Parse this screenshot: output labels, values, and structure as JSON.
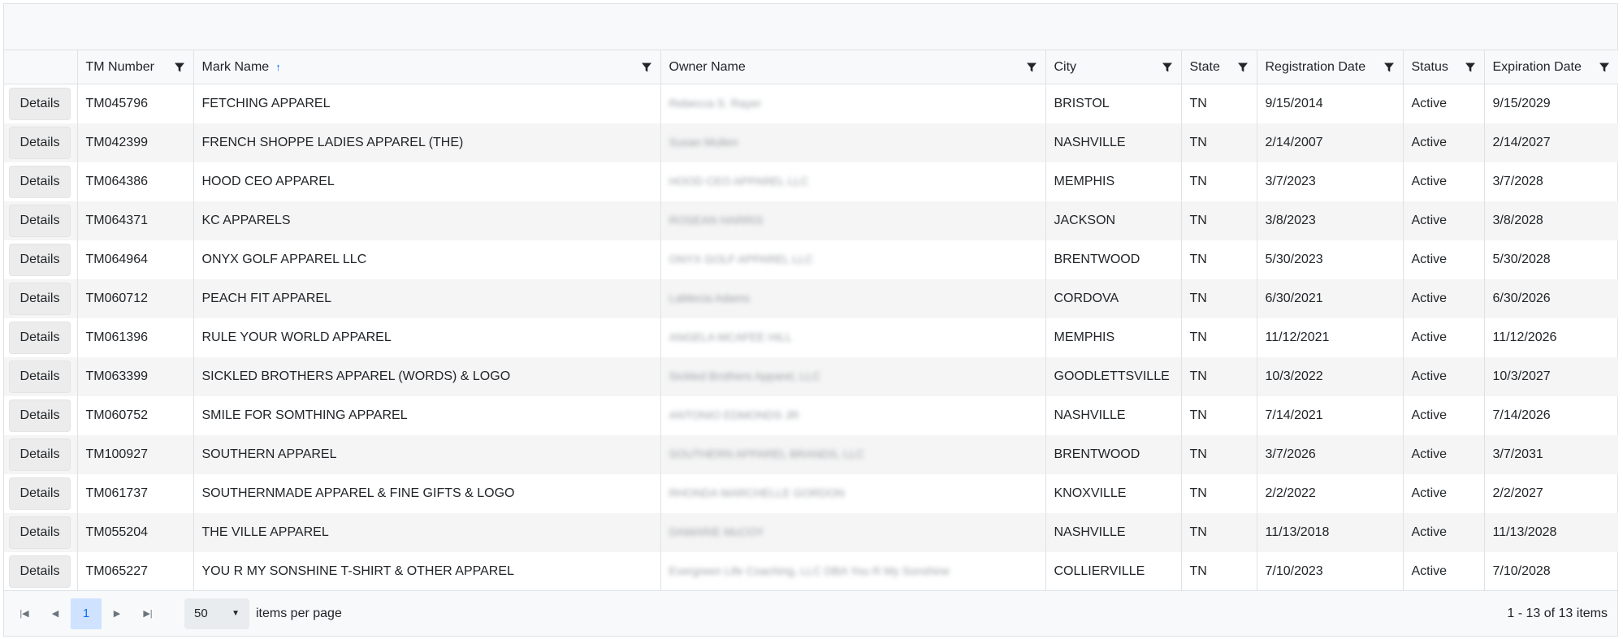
{
  "grid": {
    "columns": [
      {
        "label": ""
      },
      {
        "label": "TM Number"
      },
      {
        "label": "Mark Name"
      },
      {
        "label": "Owner Name"
      },
      {
        "label": "City"
      },
      {
        "label": "State"
      },
      {
        "label": "Registration Date"
      },
      {
        "label": "Status"
      },
      {
        "label": "Expiration Date"
      }
    ],
    "sort": {
      "column": "Mark Name",
      "direction": "ascending",
      "icon": "arrow-up-icon"
    },
    "filter_icon": "filter-icon",
    "details_label": "Details",
    "rows": [
      {
        "tm": "TM045796",
        "mark": "FETCHING APPAREL",
        "owner": "Rebecca S. Rayer",
        "city": "BRISTOL",
        "state": "TN",
        "reg": "9/15/2014",
        "status": "Active",
        "exp": "9/15/2029"
      },
      {
        "tm": "TM042399",
        "mark": "FRENCH SHOPPE LADIES APPAREL (THE)",
        "owner": "Susan Mullen",
        "city": "NASHVILLE",
        "state": "TN",
        "reg": "2/14/2007",
        "status": "Active",
        "exp": "2/14/2027"
      },
      {
        "tm": "TM064386",
        "mark": "HOOD CEO APPAREL",
        "owner": "HOOD CEO APPAREL LLC",
        "city": "MEMPHIS",
        "state": "TN",
        "reg": "3/7/2023",
        "status": "Active",
        "exp": "3/7/2028"
      },
      {
        "tm": "TM064371",
        "mark": "KC APPARELS",
        "owner": "ROSEAN HARRIS",
        "city": "JACKSON",
        "state": "TN",
        "reg": "3/8/2023",
        "status": "Active",
        "exp": "3/8/2028"
      },
      {
        "tm": "TM064964",
        "mark": "ONYX GOLF APPAREL LLC",
        "owner": "ONYX GOLF APPAREL LLC",
        "city": "BRENTWOOD",
        "state": "TN",
        "reg": "5/30/2023",
        "status": "Active",
        "exp": "5/30/2028"
      },
      {
        "tm": "TM060712",
        "mark": "PEACH FIT APPAREL",
        "owner": "LaMecia Adams",
        "city": "CORDOVA",
        "state": "TN",
        "reg": "6/30/2021",
        "status": "Active",
        "exp": "6/30/2026"
      },
      {
        "tm": "TM061396",
        "mark": "RULE YOUR WORLD APPAREL",
        "owner": "ANGELA MCAFEE HILL",
        "city": "MEMPHIS",
        "state": "TN",
        "reg": "11/12/2021",
        "status": "Active",
        "exp": "11/12/2026"
      },
      {
        "tm": "TM063399",
        "mark": "SICKLED BROTHERS APPAREL (WORDS) & LOGO",
        "owner": "Sickled Brothers Apparel, LLC",
        "city": "GOODLETTSVILLE",
        "state": "TN",
        "reg": "10/3/2022",
        "status": "Active",
        "exp": "10/3/2027"
      },
      {
        "tm": "TM060752",
        "mark": "SMILE FOR SOMTHING APPAREL",
        "owner": "ANTONIO EDMONDS JR",
        "city": "NASHVILLE",
        "state": "TN",
        "reg": "7/14/2021",
        "status": "Active",
        "exp": "7/14/2026"
      },
      {
        "tm": "TM100927",
        "mark": "SOUTHERN APPAREL",
        "owner": "SOUTHERN APPAREL BRANDS, LLC",
        "city": "BRENTWOOD",
        "state": "TN",
        "reg": "3/7/2026",
        "status": "Active",
        "exp": "3/7/2031"
      },
      {
        "tm": "TM061737",
        "mark": "SOUTHERNMADE APPAREL & FINE GIFTS & LOGO",
        "owner": "RHONDA MARCHELLE GORDON",
        "city": "KNOXVILLE",
        "state": "TN",
        "reg": "2/2/2022",
        "status": "Active",
        "exp": "2/2/2027"
      },
      {
        "tm": "TM055204",
        "mark": "THE VILLE APPAREL",
        "owner": "DAMARIE McCOY",
        "city": "NASHVILLE",
        "state": "TN",
        "reg": "11/13/2018",
        "status": "Active",
        "exp": "11/13/2028"
      },
      {
        "tm": "TM065227",
        "mark": "YOU R MY SONSHINE T-SHIRT & OTHER APPAREL",
        "owner": "Evergreen Life Coaching, LLC DBA You R My Sonshine",
        "city": "COLLIERVILLE",
        "state": "TN",
        "reg": "7/10/2023",
        "status": "Active",
        "exp": "7/10/2028"
      }
    ]
  },
  "pager": {
    "first_icon": "first-page-icon",
    "prev_icon": "previous-page-icon",
    "next_icon": "next-page-icon",
    "last_icon": "last-page-icon",
    "current_page": "1",
    "page_size": "50",
    "page_size_label": "items per page",
    "info": "1 - 13 of 13 items"
  }
}
